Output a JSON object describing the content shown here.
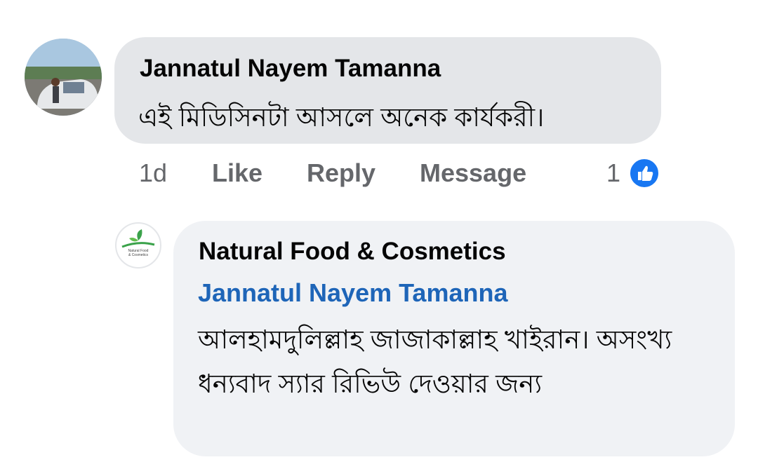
{
  "comment": {
    "author": "Jannatul Nayem Tamanna",
    "text": "এই মিডিসিনটা আসলে অনেক কার্যকরী।",
    "time": "1d",
    "like_label": "Like",
    "reply_label": "Reply",
    "message_label": "Message",
    "reaction_count": "1"
  },
  "reply": {
    "author": "Natural Food & Cosmetics",
    "mention": "Jannatul Nayem Tamanna",
    "text": "আলহামদুলিল্লাহ জাজাকাল্লাহ খাইরান। অসংখ্য ধন্যবাদ স্যার রিভিউ দেওয়ার জন্য",
    "logo_text": [
      "Natural Food",
      "& Cosmetics"
    ]
  },
  "colors": {
    "bubble_primary": "#e4e6e9",
    "bubble_reply": "#f0f2f5",
    "mention_blue": "#1e65b8",
    "like_blue": "#1877f2",
    "secondary_text": "#65676b"
  }
}
